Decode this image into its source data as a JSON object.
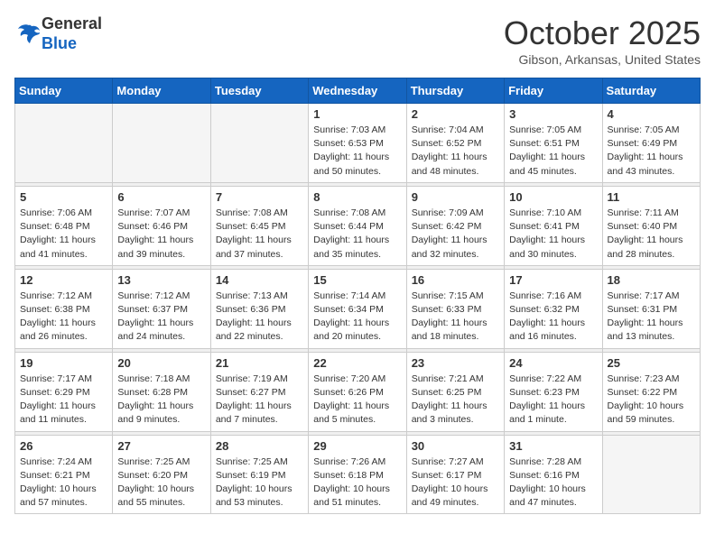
{
  "logo": {
    "general": "General",
    "blue": "Blue"
  },
  "header": {
    "month": "October 2025",
    "location": "Gibson, Arkansas, United States"
  },
  "days_of_week": [
    "Sunday",
    "Monday",
    "Tuesday",
    "Wednesday",
    "Thursday",
    "Friday",
    "Saturday"
  ],
  "weeks": [
    [
      {
        "day": "",
        "info": ""
      },
      {
        "day": "",
        "info": ""
      },
      {
        "day": "",
        "info": ""
      },
      {
        "day": "1",
        "info": "Sunrise: 7:03 AM\nSunset: 6:53 PM\nDaylight: 11 hours\nand 50 minutes."
      },
      {
        "day": "2",
        "info": "Sunrise: 7:04 AM\nSunset: 6:52 PM\nDaylight: 11 hours\nand 48 minutes."
      },
      {
        "day": "3",
        "info": "Sunrise: 7:05 AM\nSunset: 6:51 PM\nDaylight: 11 hours\nand 45 minutes."
      },
      {
        "day": "4",
        "info": "Sunrise: 7:05 AM\nSunset: 6:49 PM\nDaylight: 11 hours\nand 43 minutes."
      }
    ],
    [
      {
        "day": "5",
        "info": "Sunrise: 7:06 AM\nSunset: 6:48 PM\nDaylight: 11 hours\nand 41 minutes."
      },
      {
        "day": "6",
        "info": "Sunrise: 7:07 AM\nSunset: 6:46 PM\nDaylight: 11 hours\nand 39 minutes."
      },
      {
        "day": "7",
        "info": "Sunrise: 7:08 AM\nSunset: 6:45 PM\nDaylight: 11 hours\nand 37 minutes."
      },
      {
        "day": "8",
        "info": "Sunrise: 7:08 AM\nSunset: 6:44 PM\nDaylight: 11 hours\nand 35 minutes."
      },
      {
        "day": "9",
        "info": "Sunrise: 7:09 AM\nSunset: 6:42 PM\nDaylight: 11 hours\nand 32 minutes."
      },
      {
        "day": "10",
        "info": "Sunrise: 7:10 AM\nSunset: 6:41 PM\nDaylight: 11 hours\nand 30 minutes."
      },
      {
        "day": "11",
        "info": "Sunrise: 7:11 AM\nSunset: 6:40 PM\nDaylight: 11 hours\nand 28 minutes."
      }
    ],
    [
      {
        "day": "12",
        "info": "Sunrise: 7:12 AM\nSunset: 6:38 PM\nDaylight: 11 hours\nand 26 minutes."
      },
      {
        "day": "13",
        "info": "Sunrise: 7:12 AM\nSunset: 6:37 PM\nDaylight: 11 hours\nand 24 minutes."
      },
      {
        "day": "14",
        "info": "Sunrise: 7:13 AM\nSunset: 6:36 PM\nDaylight: 11 hours\nand 22 minutes."
      },
      {
        "day": "15",
        "info": "Sunrise: 7:14 AM\nSunset: 6:34 PM\nDaylight: 11 hours\nand 20 minutes."
      },
      {
        "day": "16",
        "info": "Sunrise: 7:15 AM\nSunset: 6:33 PM\nDaylight: 11 hours\nand 18 minutes."
      },
      {
        "day": "17",
        "info": "Sunrise: 7:16 AM\nSunset: 6:32 PM\nDaylight: 11 hours\nand 16 minutes."
      },
      {
        "day": "18",
        "info": "Sunrise: 7:17 AM\nSunset: 6:31 PM\nDaylight: 11 hours\nand 13 minutes."
      }
    ],
    [
      {
        "day": "19",
        "info": "Sunrise: 7:17 AM\nSunset: 6:29 PM\nDaylight: 11 hours\nand 11 minutes."
      },
      {
        "day": "20",
        "info": "Sunrise: 7:18 AM\nSunset: 6:28 PM\nDaylight: 11 hours\nand 9 minutes."
      },
      {
        "day": "21",
        "info": "Sunrise: 7:19 AM\nSunset: 6:27 PM\nDaylight: 11 hours\nand 7 minutes."
      },
      {
        "day": "22",
        "info": "Sunrise: 7:20 AM\nSunset: 6:26 PM\nDaylight: 11 hours\nand 5 minutes."
      },
      {
        "day": "23",
        "info": "Sunrise: 7:21 AM\nSunset: 6:25 PM\nDaylight: 11 hours\nand 3 minutes."
      },
      {
        "day": "24",
        "info": "Sunrise: 7:22 AM\nSunset: 6:23 PM\nDaylight: 11 hours\nand 1 minute."
      },
      {
        "day": "25",
        "info": "Sunrise: 7:23 AM\nSunset: 6:22 PM\nDaylight: 10 hours\nand 59 minutes."
      }
    ],
    [
      {
        "day": "26",
        "info": "Sunrise: 7:24 AM\nSunset: 6:21 PM\nDaylight: 10 hours\nand 57 minutes."
      },
      {
        "day": "27",
        "info": "Sunrise: 7:25 AM\nSunset: 6:20 PM\nDaylight: 10 hours\nand 55 minutes."
      },
      {
        "day": "28",
        "info": "Sunrise: 7:25 AM\nSunset: 6:19 PM\nDaylight: 10 hours\nand 53 minutes."
      },
      {
        "day": "29",
        "info": "Sunrise: 7:26 AM\nSunset: 6:18 PM\nDaylight: 10 hours\nand 51 minutes."
      },
      {
        "day": "30",
        "info": "Sunrise: 7:27 AM\nSunset: 6:17 PM\nDaylight: 10 hours\nand 49 minutes."
      },
      {
        "day": "31",
        "info": "Sunrise: 7:28 AM\nSunset: 6:16 PM\nDaylight: 10 hours\nand 47 minutes."
      },
      {
        "day": "",
        "info": ""
      }
    ]
  ]
}
